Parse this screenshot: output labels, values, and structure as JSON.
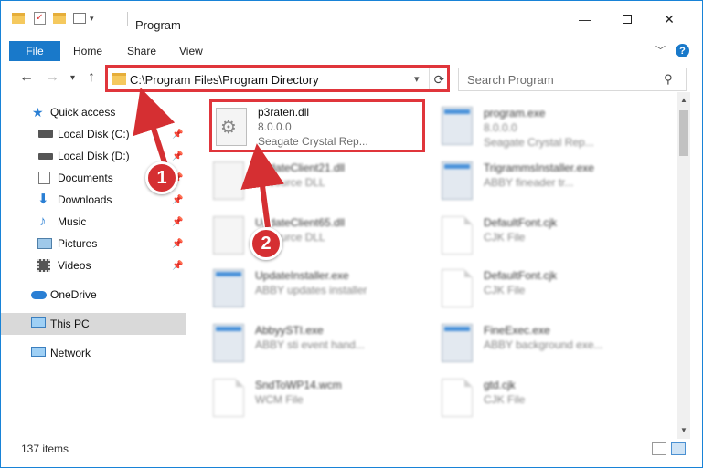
{
  "window": {
    "title": "Program"
  },
  "ribbon": {
    "tabs": [
      {
        "label": "File"
      },
      {
        "label": "Home"
      },
      {
        "label": "Share"
      },
      {
        "label": "View"
      }
    ]
  },
  "nav": {
    "address": "C:\\Program Files\\Program Directory",
    "search_placeholder": "Search Program"
  },
  "sidebar": {
    "items": [
      {
        "label": "Quick access",
        "icon": "star-icon"
      },
      {
        "label": "Local Disk (C:)",
        "icon": "drive-icon",
        "pinned": true
      },
      {
        "label": "Local Disk (D:)",
        "icon": "drive-icon",
        "pinned": true
      },
      {
        "label": "Documents",
        "icon": "documents-icon",
        "pinned": true
      },
      {
        "label": "Downloads",
        "icon": "downloads-icon",
        "pinned": true
      },
      {
        "label": "Music",
        "icon": "music-icon",
        "pinned": true
      },
      {
        "label": "Pictures",
        "icon": "pictures-icon",
        "pinned": true
      },
      {
        "label": "Videos",
        "icon": "videos-icon",
        "pinned": true
      },
      {
        "label": "OneDrive",
        "icon": "onedrive-icon"
      },
      {
        "label": "This PC",
        "icon": "computer-icon",
        "selected": true
      },
      {
        "label": "Network",
        "icon": "network-icon"
      }
    ]
  },
  "files": [
    {
      "name": "p3raten.dll",
      "line2": "8.0.0.0",
      "line3": "Seagate Crystal Rep...",
      "type": "dll"
    },
    {
      "name": "program.exe",
      "line2": "8.0.0.0",
      "line3": "Seagate Crystal Rep...",
      "type": "exe"
    },
    {
      "name": "UpdateClient21.dll",
      "line2": "Resource DLL",
      "line3": "",
      "type": "dll"
    },
    {
      "name": "TrigrammsInstaller.exe",
      "line2": "ABBY fineader tr...",
      "line3": "",
      "type": "exe"
    },
    {
      "name": "UpdateClient65.dll",
      "line2": "Resource DLL",
      "line3": "",
      "type": "dll"
    },
    {
      "name": "DefaultFont.cjk",
      "line2": "CJK File",
      "line3": "",
      "type": "doc"
    },
    {
      "name": "UpdateInstaller.exe",
      "line2": "ABBY updates installer",
      "line3": "",
      "type": "exe"
    },
    {
      "name": "DefaultFont.cjk",
      "line2": "CJK File",
      "line3": "",
      "type": "doc"
    },
    {
      "name": "AbbyySTI.exe",
      "line2": "ABBY sti event hand...",
      "line3": "",
      "type": "exe"
    },
    {
      "name": "FineExec.exe",
      "line2": "ABBY background exe...",
      "line3": "",
      "type": "exe"
    },
    {
      "name": "SndToWP14.wcm",
      "line2": "WCM File",
      "line3": "",
      "type": "doc"
    },
    {
      "name": "gtd.cjk",
      "line2": "CJK File",
      "line3": "",
      "type": "doc"
    }
  ],
  "status": {
    "count": "137 items"
  },
  "annotations": [
    {
      "label": "1"
    },
    {
      "label": "2"
    }
  ],
  "colors": {
    "accent": "#1979ca",
    "highlight": "#e0353b",
    "badge": "#d52f32"
  }
}
